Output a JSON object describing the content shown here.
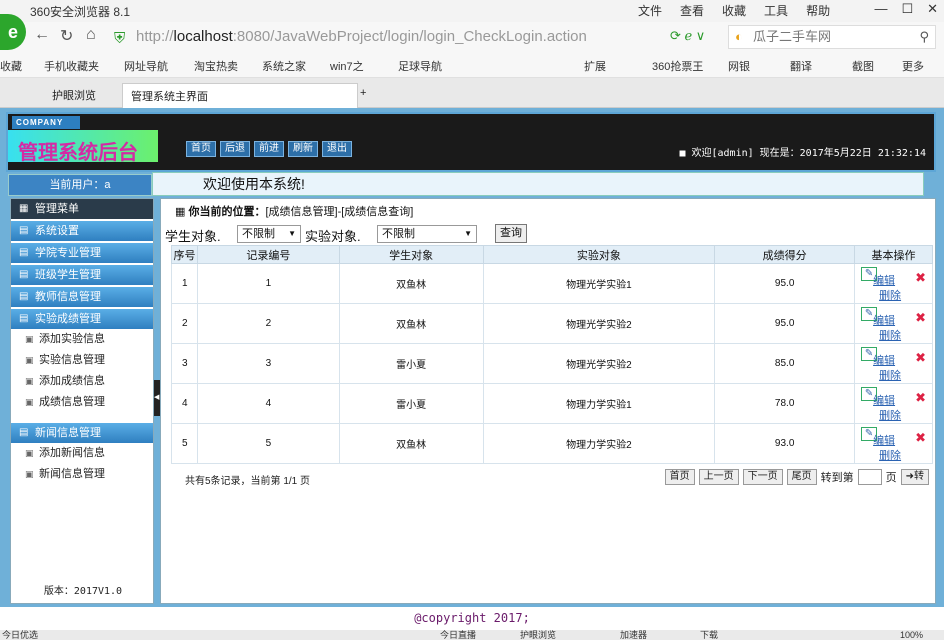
{
  "browser": {
    "title": "360安全浏览器 8.1",
    "menu": [
      "文件",
      "查看",
      "收藏",
      "工具",
      "帮助"
    ],
    "url_prefix": "http://",
    "url_host": "localhost",
    "url_rest": ":8080/JavaWebProject/login/login_CheckLogin.action",
    "search_placeholder": "瓜子二手车网",
    "bookmarks": [
      "收藏",
      "手机收藏夹",
      "网址导航",
      "淘宝热卖",
      "系统之家",
      "win7之",
      "足球导航",
      "扩展",
      "360抢票王",
      "网银",
      "翻译",
      "截图",
      "更多"
    ],
    "tabs": [
      "护眼浏览",
      "管理系统主界面"
    ],
    "status": [
      "今日优选",
      "今日直播",
      "护眼浏览",
      "加速器",
      "下载",
      "100%"
    ]
  },
  "header": {
    "company": "COMPANY",
    "title": "管理系统后台",
    "buttons": [
      "首页",
      "后退",
      "前进",
      "刷新",
      "退出"
    ],
    "welcome": "■ 欢迎[admin]  现在是：2017年5月22日 21:32:14"
  },
  "userbar": "当前用户：a",
  "welcome_text": "欢迎使用本系统!",
  "sidebar": {
    "menu_title": "管理菜单",
    "groups": [
      {
        "label": "系统设置",
        "items": []
      },
      {
        "label": "学院专业管理",
        "items": []
      },
      {
        "label": "班级学生管理",
        "items": []
      },
      {
        "label": "教师信息管理",
        "items": []
      },
      {
        "label": "实验成绩管理",
        "items": [
          "添加实验信息",
          "实验信息管理",
          "添加成绩信息",
          "成绩信息管理"
        ]
      },
      {
        "label": "新闻信息管理",
        "items": [
          "添加新闻信息",
          "新闻信息管理"
        ]
      }
    ],
    "version": "版本：2017V1.0"
  },
  "main": {
    "breadcrumb_label": "你当前的位置：",
    "breadcrumb_path": "[成绩信息管理]-[成绩信息查询]",
    "filter_student_label": "学生对象.",
    "filter_student_value": "不限制",
    "filter_experiment_label": "实验对象.",
    "filter_experiment_value": "不限制",
    "query_button": "查询",
    "columns": [
      "序号",
      "记录编号",
      "学生对象",
      "实验对象",
      "成绩得分",
      "基本操作"
    ],
    "rows": [
      [
        "1",
        "1",
        "双鱼林",
        "物理光学实验1",
        "95.0"
      ],
      [
        "2",
        "2",
        "双鱼林",
        "物理光学实验2",
        "95.0"
      ],
      [
        "3",
        "3",
        "雷小夏",
        "物理光学实验2",
        "85.0"
      ],
      [
        "4",
        "4",
        "雷小夏",
        "物理力学实验1",
        "78.0"
      ],
      [
        "5",
        "5",
        "双鱼林",
        "物理力学实验2",
        "93.0"
      ]
    ],
    "edit_label": "编辑",
    "delete_label": "删除",
    "pager_info": "共有5条记录，当前第 1/1 页",
    "pager_buttons": [
      "首页",
      "上一页",
      "下一页",
      "尾页"
    ],
    "goto_label": "转到第",
    "page_label": "页",
    "go_button": "转"
  },
  "footer": "@copyright 2017;"
}
